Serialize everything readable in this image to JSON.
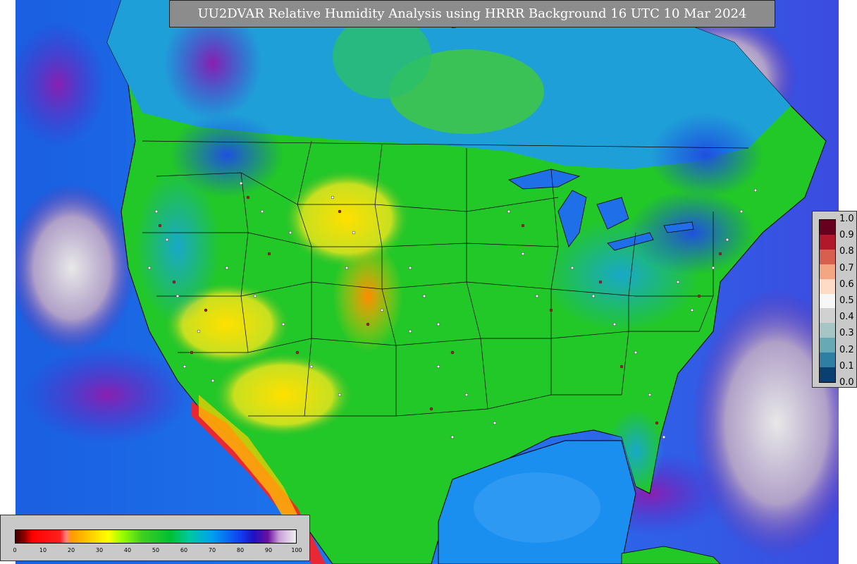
{
  "title": "UU2DVAR Relative Humidity Analysis using HRRR Background 16 UTC 10 Mar 2024",
  "colors": {
    "ocean": "#1565e8",
    "background_land": "#c7c7c7",
    "land_moist": "#22c728",
    "land_dry": "#ffd400",
    "desert_red": "#ff1a1a",
    "high_humidity": "#7a1fa8"
  },
  "error_colorbar": {
    "ticks": [
      "0.0",
      "0.1",
      "0.2",
      "0.3",
      "0.4",
      "0.5",
      "0.6",
      "0.7",
      "0.8",
      "0.9",
      "1.0"
    ],
    "colors": [
      "#67001f",
      "#b2182b",
      "#d6604d",
      "#f4a582",
      "#fddbc7",
      "#f7f7f7",
      "#d1d1d1",
      "#a6c5c5",
      "#67a9b5",
      "#2f7fa5",
      "#0b3f6f"
    ]
  },
  "rh_colorbar": {
    "ticks": [
      "0",
      "10",
      "20",
      "30",
      "40",
      "50",
      "60",
      "70",
      "80",
      "90",
      "100"
    ]
  }
}
